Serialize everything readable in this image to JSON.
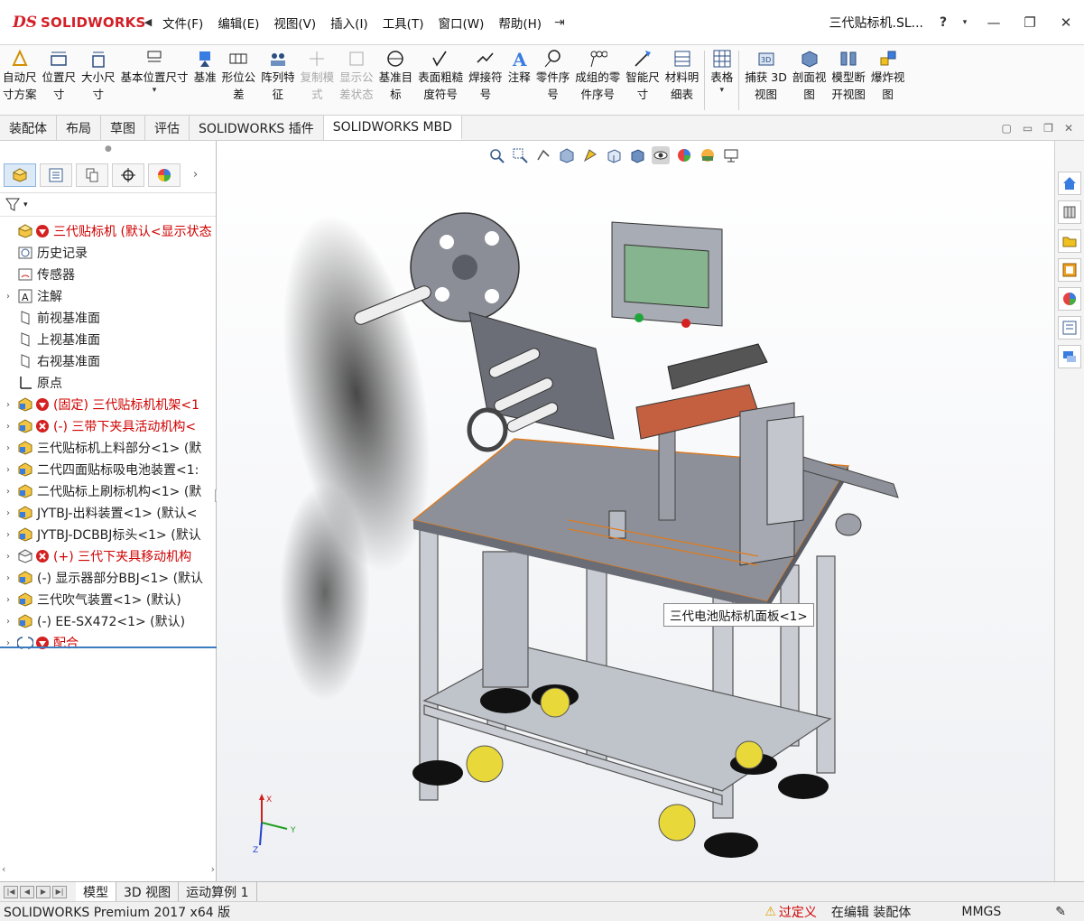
{
  "app": {
    "logo_prefix": "DS",
    "logo_text": "SOLIDWORKS",
    "doc_title": "三代贴标机.SL...",
    "help_icon": "help-icon"
  },
  "menu": [
    "文件(F)",
    "编辑(E)",
    "视图(V)",
    "插入(I)",
    "工具(T)",
    "窗口(W)",
    "帮助(H)"
  ],
  "commands": [
    {
      "label": "自动尺\n寸方案",
      "icon": "auto-dimension-icon"
    },
    {
      "label": "位置尺\n寸",
      "icon": "location-dimension-icon"
    },
    {
      "label": "大小尺\n寸",
      "icon": "size-dimension-icon"
    },
    {
      "label": "基本位置尺寸",
      "icon": "basic-location-dimension-icon"
    },
    {
      "label": "基准",
      "icon": "datum-icon"
    },
    {
      "label": "形位公\n差",
      "icon": "geometric-tolerance-icon"
    },
    {
      "label": "阵列特\n征",
      "icon": "pattern-feature-icon"
    },
    {
      "label": "复制模\n式",
      "icon": "copy-scheme-icon",
      "disabled": true
    },
    {
      "label": "显示公\n差状态",
      "icon": "show-tolerance-status-icon",
      "disabled": true
    },
    {
      "label": "基准目\n标",
      "icon": "datum-target-icon"
    },
    {
      "label": "表面粗糙\n度符号",
      "icon": "surface-finish-icon"
    },
    {
      "label": "焊接符\n号",
      "icon": "weld-symbol-icon"
    },
    {
      "label": "注释",
      "icon": "note-icon"
    },
    {
      "label": "零件序\n号",
      "icon": "balloon-icon"
    },
    {
      "label": "成组的零\n件序号",
      "icon": "stacked-balloon-icon"
    },
    {
      "label": "智能尺\n寸",
      "icon": "smart-dimension-icon"
    },
    {
      "label": "材料明\n细表",
      "icon": "bom-icon"
    },
    {
      "label": "表格",
      "icon": "table-icon"
    },
    {
      "label": "捕获 3D\n视图",
      "icon": "capture-3d-view-icon"
    },
    {
      "label": "剖面视\n图",
      "icon": "section-view-icon"
    },
    {
      "label": "模型断\n开视图",
      "icon": "model-break-view-icon"
    },
    {
      "label": "爆炸视\n图",
      "icon": "exploded-view-icon"
    }
  ],
  "tabs": [
    "装配体",
    "布局",
    "草图",
    "评估",
    "SOLIDWORKS 插件",
    "SOLIDWORKS MBD"
  ],
  "active_tab": "SOLIDWORKS MBD",
  "tree": [
    {
      "text": "三代贴标机  (默认<显示状态",
      "icon": "assembly-icon",
      "status": "error",
      "expand": false
    },
    {
      "text": "历史记录",
      "icon": "history-icon"
    },
    {
      "text": "传感器",
      "icon": "sensor-icon"
    },
    {
      "text": "注解",
      "icon": "annotation-icon",
      "expand": true
    },
    {
      "text": "前视基准面",
      "icon": "plane-icon"
    },
    {
      "text": "上视基准面",
      "icon": "plane-icon"
    },
    {
      "text": "右视基准面",
      "icon": "plane-icon"
    },
    {
      "text": "原点",
      "icon": "origin-icon"
    },
    {
      "text": "(固定) 三代贴标机机架<1",
      "icon": "subassembly-icon",
      "status": "error",
      "expand": true
    },
    {
      "text": "(-) 三带下夹具活动机构<",
      "icon": "subassembly-icon",
      "status": "x",
      "expand": true
    },
    {
      "text": "三代贴标机上料部分<1> (默",
      "icon": "subassembly-icon",
      "expand": true
    },
    {
      "text": "二代四面贴标吸电池装置<1:",
      "icon": "subassembly-icon",
      "expand": true
    },
    {
      "text": "二代贴标上刷标机构<1> (默",
      "icon": "subassembly-icon",
      "expand": true
    },
    {
      "text": "JYTBJ-出料装置<1> (默认<",
      "icon": "subassembly-icon",
      "expand": true
    },
    {
      "text": "JYTBJ-DCBBJ标头<1> (默认",
      "icon": "subassembly-icon",
      "expand": true
    },
    {
      "text": "(+) 三代下夹具移动机构",
      "icon": "subassembly-outline-icon",
      "status": "x",
      "expand": true
    },
    {
      "text": "(-) 显示器部分BBJ<1> (默认",
      "icon": "subassembly-icon",
      "expand": true
    },
    {
      "text": "三代吹气装置<1> (默认)",
      "icon": "subassembly-icon",
      "expand": true
    },
    {
      "text": "(-) EE-SX472<1> (默认)",
      "icon": "subassembly-icon",
      "expand": true
    },
    {
      "text": "配合",
      "icon": "mates-icon",
      "status": "error",
      "expand": true
    }
  ],
  "tooltip": "三代电池贴标机面板<1>",
  "bottom_tabs": [
    "模型",
    "3D 视图",
    "运动算例 1"
  ],
  "status": {
    "left": "SOLIDWORKS Premium 2017 x64 版",
    "warning": "过定义",
    "mode": "在编辑 装配体",
    "units": "MMGS"
  },
  "colors": {
    "error_red": "#d00000",
    "accent_blue": "#3b7bbf",
    "brand_red": "#d32027"
  }
}
